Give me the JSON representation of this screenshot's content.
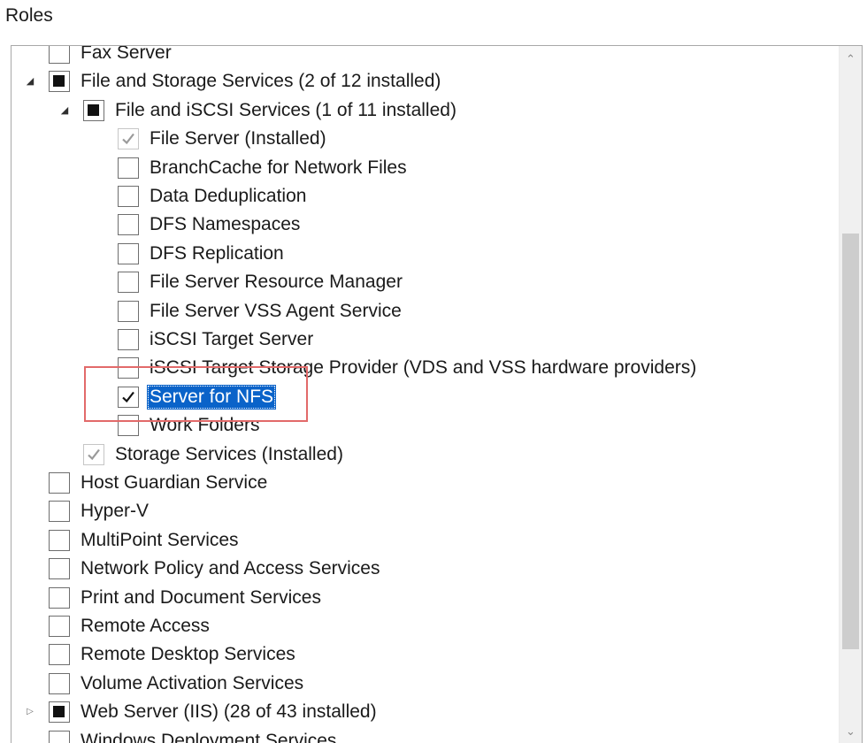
{
  "heading": "Roles",
  "rows": [
    {
      "label": "Fax Server",
      "state": "none",
      "level": 1,
      "expander": ""
    },
    {
      "label": "File and Storage Services (2 of 12 installed)",
      "state": "partial",
      "level": 1,
      "expander": "expanded"
    },
    {
      "label": "File and iSCSI Services (1 of 11 installed)",
      "state": "partial",
      "level": 2,
      "expander": "expanded"
    },
    {
      "label": "File Server (Installed)",
      "state": "installed",
      "level": 3,
      "expander": ""
    },
    {
      "label": "BranchCache for Network Files",
      "state": "none",
      "level": 3,
      "expander": ""
    },
    {
      "label": "Data Deduplication",
      "state": "none",
      "level": 3,
      "expander": ""
    },
    {
      "label": "DFS Namespaces",
      "state": "none",
      "level": 3,
      "expander": ""
    },
    {
      "label": "DFS Replication",
      "state": "none",
      "level": 3,
      "expander": ""
    },
    {
      "label": "File Server Resource Manager",
      "state": "none",
      "level": 3,
      "expander": ""
    },
    {
      "label": "File Server VSS Agent Service",
      "state": "none",
      "level": 3,
      "expander": ""
    },
    {
      "label": "iSCSI Target Server",
      "state": "none",
      "level": 3,
      "expander": ""
    },
    {
      "label": "iSCSI Target Storage Provider (VDS and VSS hardware providers)",
      "state": "none",
      "level": 3,
      "expander": ""
    },
    {
      "label": "Server for NFS",
      "state": "checked",
      "level": 3,
      "expander": "",
      "selected": true
    },
    {
      "label": "Work Folders",
      "state": "none",
      "level": 3,
      "expander": ""
    },
    {
      "label": "Storage Services (Installed)",
      "state": "installed",
      "level": 2,
      "expander": ""
    },
    {
      "label": "Host Guardian Service",
      "state": "none",
      "level": 1,
      "expander": ""
    },
    {
      "label": "Hyper-V",
      "state": "none",
      "level": 1,
      "expander": ""
    },
    {
      "label": "MultiPoint Services",
      "state": "none",
      "level": 1,
      "expander": ""
    },
    {
      "label": "Network Policy and Access Services",
      "state": "none",
      "level": 1,
      "expander": ""
    },
    {
      "label": "Print and Document Services",
      "state": "none",
      "level": 1,
      "expander": ""
    },
    {
      "label": "Remote Access",
      "state": "none",
      "level": 1,
      "expander": ""
    },
    {
      "label": "Remote Desktop Services",
      "state": "none",
      "level": 1,
      "expander": ""
    },
    {
      "label": "Volume Activation Services",
      "state": "none",
      "level": 1,
      "expander": ""
    },
    {
      "label": "Web Server (IIS) (28 of 43 installed)",
      "state": "partial",
      "level": 1,
      "expander": "collapsed"
    },
    {
      "label": "Windows Deployment Services",
      "state": "none",
      "level": 1,
      "expander": ""
    }
  ],
  "colors": {
    "selection": "#0a63c9",
    "annotation_box": "#e26a6a"
  },
  "icons": {
    "expanded": "expanded-triangle-icon",
    "collapsed": "collapsed-triangle-icon",
    "scroll_up": "chevron-up-icon",
    "scroll_down": "chevron-down-icon"
  }
}
